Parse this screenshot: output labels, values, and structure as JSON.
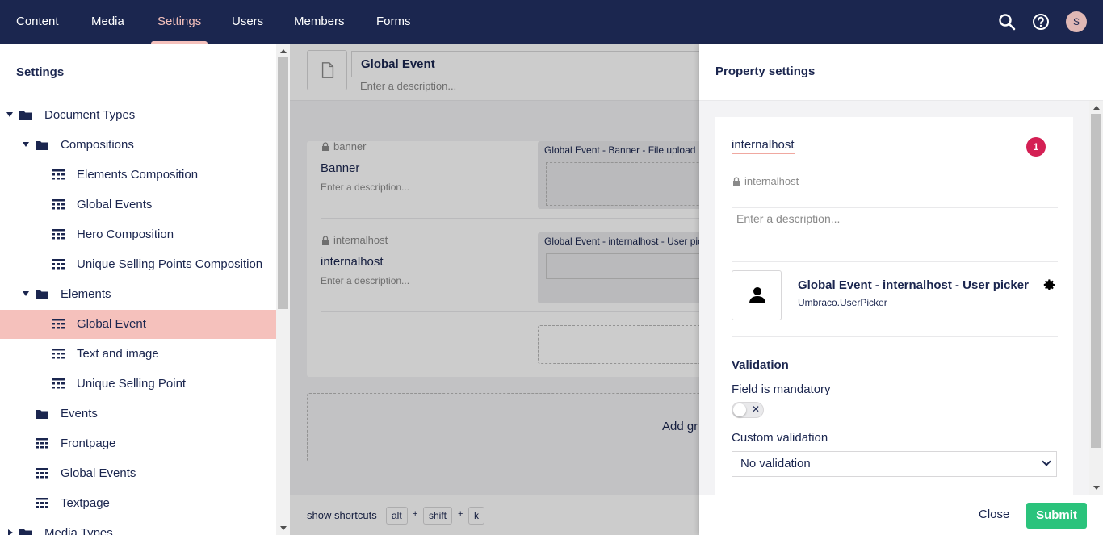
{
  "nav": {
    "items": [
      "Content",
      "Media",
      "Settings",
      "Users",
      "Members",
      "Forms"
    ],
    "active": "Settings",
    "avatar_initial": "S"
  },
  "sidebar": {
    "title": "Settings",
    "items": [
      {
        "label": "Document Types",
        "icon": "folder-icon"
      },
      {
        "label": "Compositions",
        "icon": "folder-icon"
      },
      {
        "label": "Elements Composition",
        "icon": "document-type-icon"
      },
      {
        "label": "Global Events",
        "icon": "document-type-icon"
      },
      {
        "label": "Hero Composition",
        "icon": "document-type-icon"
      },
      {
        "label": "Unique Selling Points Composition",
        "icon": "document-type-icon"
      },
      {
        "label": "Elements",
        "icon": "folder-icon"
      },
      {
        "label": "Global Event",
        "icon": "document-type-icon"
      },
      {
        "label": "Text and image",
        "icon": "document-type-icon"
      },
      {
        "label": "Unique Selling Point",
        "icon": "document-type-icon"
      },
      {
        "label": "Events",
        "icon": "folder-icon"
      },
      {
        "label": "Frontpage",
        "icon": "document-type-icon"
      },
      {
        "label": "Global Events",
        "icon": "document-type-icon"
      },
      {
        "label": "Textpage",
        "icon": "document-type-icon"
      },
      {
        "label": "Media Types",
        "icon": "folder-icon"
      }
    ]
  },
  "main": {
    "name": "Global Event",
    "description_placeholder": "Enter a description...",
    "properties": [
      {
        "alias": "banner",
        "name": "Banner",
        "description_placeholder": "Enter a description...",
        "editor_label": "Global Event - Banner - File upload"
      },
      {
        "alias": "internalhost",
        "name": "internalhost",
        "description_placeholder": "Enter a description...",
        "editor_label": "Global Event - internalhost - User picker"
      }
    ],
    "add_group_label": "Add gr",
    "shortcuts_label": "show shortcuts",
    "keys": [
      "alt",
      "shift",
      "k"
    ]
  },
  "panel": {
    "title": "Property settings",
    "property_name": "internalhost",
    "error_count": "1",
    "alias": "internalhost",
    "description_placeholder": "Enter a description...",
    "editor_name": "Global Event - internalhost - User picker",
    "editor_alias": "Umbraco.UserPicker",
    "validation_title": "Validation",
    "mandatory_label": "Field is mandatory",
    "mandatory_value": false,
    "custom_validation_label": "Custom validation",
    "custom_validation_value": "No validation",
    "close_label": "Close",
    "submit_label": "Submit",
    "colors": {
      "submit": "#2bc37c",
      "error": "#d42054",
      "nav": "#1b264f",
      "active_highlight": "#f5c1bc"
    }
  }
}
